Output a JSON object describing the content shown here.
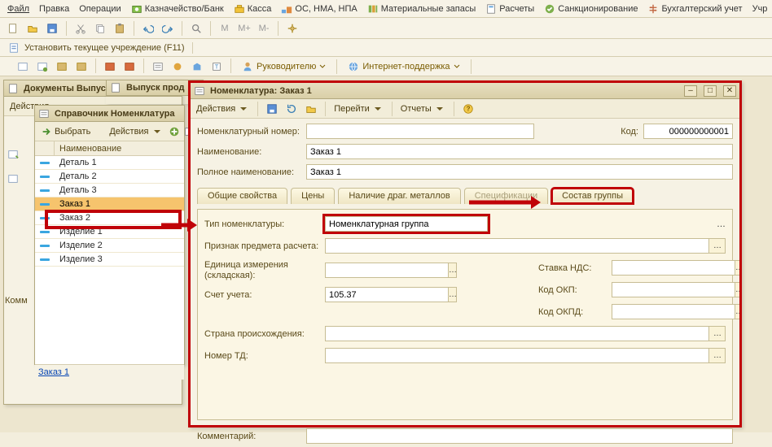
{
  "menubar": {
    "file": "Файл",
    "edit": "Правка",
    "ops": "Операции",
    "treasury": "Казначейство/Банк",
    "cash": "Касса",
    "assets": "ОС, НМА, НПА",
    "inventory": "Материальные запасы",
    "calc": "Расчеты",
    "sanction": "Санкционирование",
    "accounting": "Бухгалтерский учет",
    "uchr": "Учр"
  },
  "f11": "Установить текущее учреждение (F11)",
  "tlinks": {
    "ruk": "Руководителю",
    "internet": "Интернет-поддержка"
  },
  "win_doc": {
    "title": "Документы Выпус"
  },
  "win_vp": {
    "title": "Выпуск прод"
  },
  "win_dict": {
    "title": "Справочник Номенклатура",
    "select": "Выбрать",
    "actions": "Действия",
    "col": "Наименование",
    "rows": [
      "Деталь 1",
      "Деталь 2",
      "Деталь 3",
      "Заказ 1",
      "Заказ 2",
      "Изделие  1",
      "Изделие  2",
      "Изделие 3"
    ],
    "foot": "Заказ 1"
  },
  "win_nomen": {
    "title": "Номенклатура:  Заказ 1",
    "actions": "Действия",
    "goto": "Перейти",
    "reports": "Отчеты",
    "lbl_num": "Номенклатурный номер:",
    "lbl_code": "Код:",
    "code": "000000000001",
    "lbl_name": "Наименование:",
    "name": "Заказ 1",
    "lbl_fullname": "Полное наименование:",
    "fullname": "Заказ 1",
    "tabs": {
      "common": "Общие свойства",
      "prices": "Цены",
      "metals": "Наличие драг. металлов",
      "spec": "Спецификации",
      "group": "Состав группы"
    },
    "lbl_type": "Тип номенклатуры:",
    "type": "Номенклатурная группа",
    "lbl_attr": "Признак предмета расчета:",
    "lbl_unit1": "Единица измерения",
    "lbl_unit2": "(складская):",
    "lbl_nds": "Ставка НДС:",
    "lbl_account": "Счет учета:",
    "account": "105.37",
    "lbl_okp": "Код ОКП:",
    "lbl_okpd": "Код ОКПД:",
    "lbl_country": "Страна происхождения:",
    "lbl_td": "Номер ТД:",
    "lbl_comment": "Комментарий:"
  },
  "side": {
    "comment": "Комм"
  }
}
